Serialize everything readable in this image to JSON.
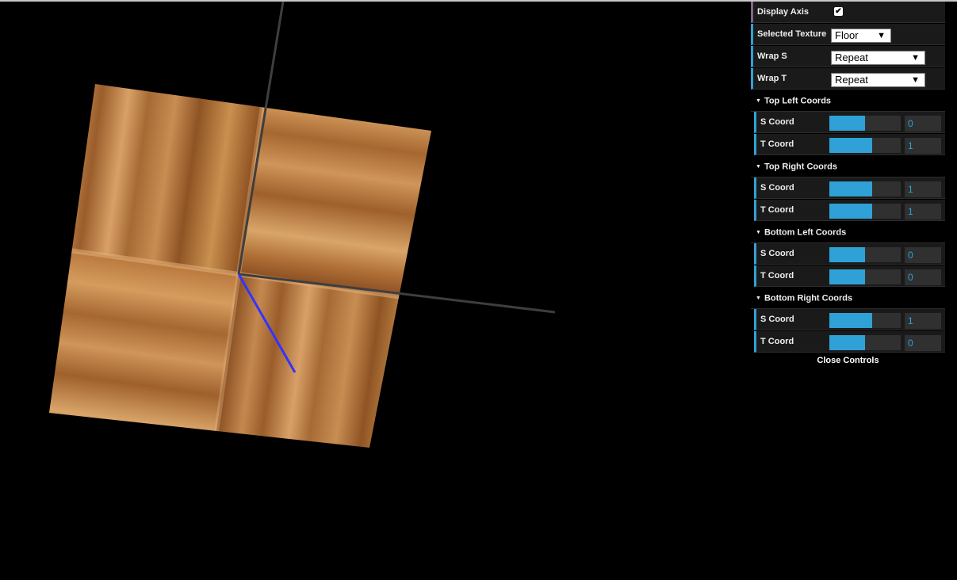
{
  "controls": {
    "display_axis": {
      "label": "Display Axis",
      "checked": true,
      "check_glyph": "✔"
    },
    "selected_texture": {
      "label": "Selected Texture",
      "value": "Floor"
    },
    "wrap_s": {
      "label": "Wrap S",
      "value": "Repeat"
    },
    "wrap_t": {
      "label": "Wrap T",
      "value": "Repeat"
    }
  },
  "folders": [
    {
      "title": "Top Left Coords",
      "s": {
        "label": "S Coord",
        "value": "0",
        "fill": 0.5
      },
      "t": {
        "label": "T Coord",
        "value": "1",
        "fill": 0.6
      }
    },
    {
      "title": "Top Right Coords",
      "s": {
        "label": "S Coord",
        "value": "1",
        "fill": 0.6
      },
      "t": {
        "label": "T Coord",
        "value": "1",
        "fill": 0.6
      }
    },
    {
      "title": "Bottom Left Coords",
      "s": {
        "label": "S Coord",
        "value": "0",
        "fill": 0.5
      },
      "t": {
        "label": "T Coord",
        "value": "0",
        "fill": 0.5
      }
    },
    {
      "title": "Bottom Right Coords",
      "s": {
        "label": "S Coord",
        "value": "1",
        "fill": 0.6
      },
      "t": {
        "label": "T Coord",
        "value": "0",
        "fill": 0.5
      }
    }
  ],
  "close_label": "Close Controls",
  "dropdown_arrow": "▼",
  "folder_arrow": "▼",
  "colors": {
    "accent": "#2fa1d6",
    "background": "#000000",
    "panel": "#1a1a1a",
    "axis_z": "#3333ff",
    "axis_xy": "#444444"
  }
}
